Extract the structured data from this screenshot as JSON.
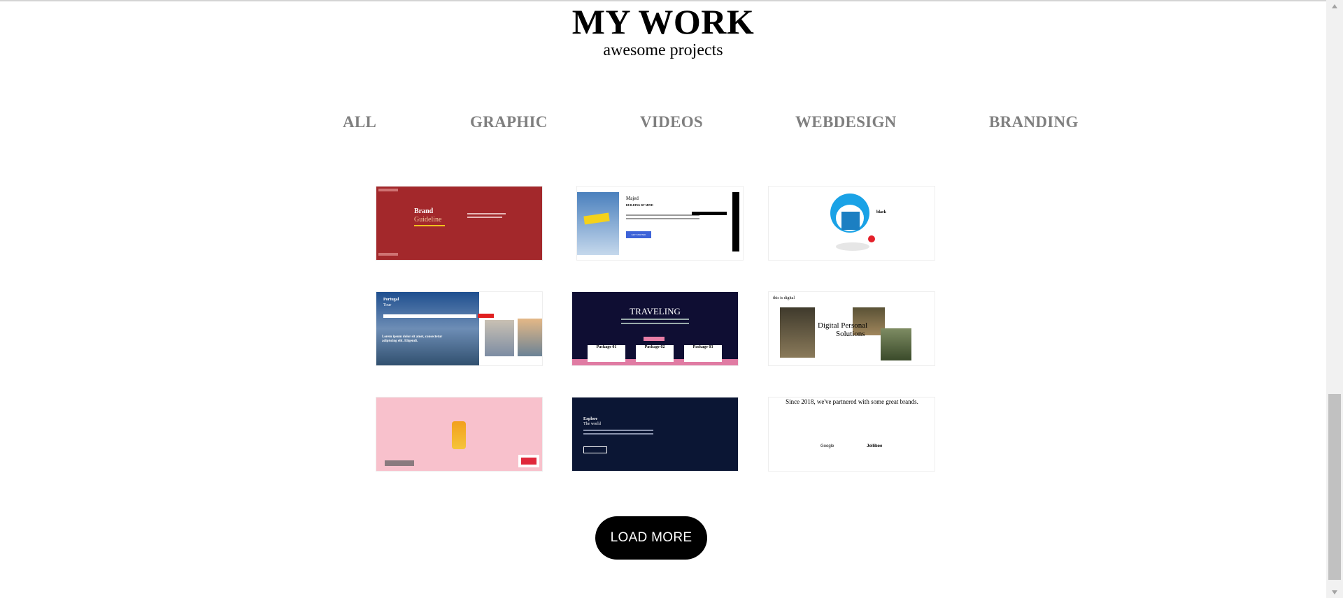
{
  "header": {
    "title": "MY WORK",
    "subtitle": "awesome projects"
  },
  "filters": [
    "ALL",
    "GRAPHIC",
    "VIDEOS",
    "WEBDESIGN",
    "BRANDING"
  ],
  "projects": {
    "brand": {
      "line1": "Brand",
      "line2": "Guideline"
    },
    "majed": {
      "name": "Majed",
      "headline": "BUILDING BY MIND",
      "cta": "GET STARTED"
    },
    "doraemon": {
      "word": "black"
    },
    "portugal": {
      "line1": "Portugal",
      "line2": "Tour",
      "headline": "Lorem ipsum dolor sit amet, consectetur adipiscing elit. Eligendi."
    },
    "traveling": {
      "title": "TRAVELING",
      "packages": [
        "Package 01",
        "Package 02",
        "Package 03"
      ]
    },
    "digital": {
      "tagline": "this is digital",
      "line1": "Digital Personal",
      "line2": "Solutions"
    },
    "explore": {
      "line1": "Explore",
      "line2": "The world"
    },
    "brands": {
      "heading": "Since 2018, we've partnered with some great brands.",
      "logos": [
        "Google",
        "Jollibee"
      ]
    }
  },
  "load_more": {
    "label": "LOAD MORE"
  },
  "colors": {
    "accent": "#000000",
    "filter_text": "#7f7f7f",
    "brand_red": "#a3282b",
    "navy": "#0f0e33",
    "pink": "#f8c1cc"
  }
}
